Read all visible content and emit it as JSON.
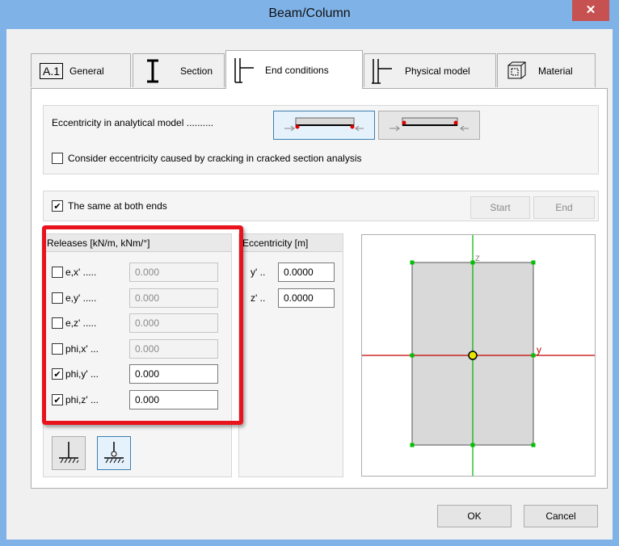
{
  "window": {
    "title": "Beam/Column",
    "close_label": "✕"
  },
  "tabs": [
    {
      "id": "general",
      "label": "General",
      "icon_text": "A.1",
      "active": false
    },
    {
      "id": "section",
      "label": "Section",
      "active": false
    },
    {
      "id": "end_conditions",
      "label": "End conditions",
      "active": true
    },
    {
      "id": "physical_model",
      "label": "Physical model",
      "active": false
    },
    {
      "id": "material",
      "label": "Material",
      "active": false
    }
  ],
  "eccentricity_panel": {
    "label": "Eccentricity in analytical model ..........",
    "crack_checkbox_label": "Consider eccentricity caused by cracking in cracked section analysis",
    "crack_checked": false
  },
  "ends_panel": {
    "same_both_ends_label": "The same at both ends",
    "same_both_ends_checked": true,
    "start_label": "Start",
    "end_label": "End"
  },
  "releases": {
    "header": "Releases [kN/m, kNm/°]",
    "rows": [
      {
        "label": "e,x' .....",
        "value": "0.000",
        "checked": false
      },
      {
        "label": "e,y' .....",
        "value": "0.000",
        "checked": false
      },
      {
        "label": "e,z' .....",
        "value": "0.000",
        "checked": false
      },
      {
        "label": "phi,x' ...",
        "value": "0.000",
        "checked": false
      },
      {
        "label": "phi,y' ...",
        "value": "0.000",
        "checked": true
      },
      {
        "label": "phi,z' ...",
        "value": "0.000",
        "checked": true
      }
    ]
  },
  "eccentricity": {
    "header": "Eccentricity [m]",
    "rows": [
      {
        "label": "y' ..",
        "value": "0.0000"
      },
      {
        "label": "z' ..",
        "value": "0.0000"
      }
    ]
  },
  "preview": {
    "axis_y_label": "y",
    "axis_z_label": "z"
  },
  "footer": {
    "ok_label": "OK",
    "cancel_label": "Cancel"
  },
  "colors": {
    "highlight": "#e8131d",
    "titlebar": "#7fb3e8",
    "axis_y": "#c00000",
    "axis_z": "#00b000",
    "centroid": "#e6e600"
  }
}
